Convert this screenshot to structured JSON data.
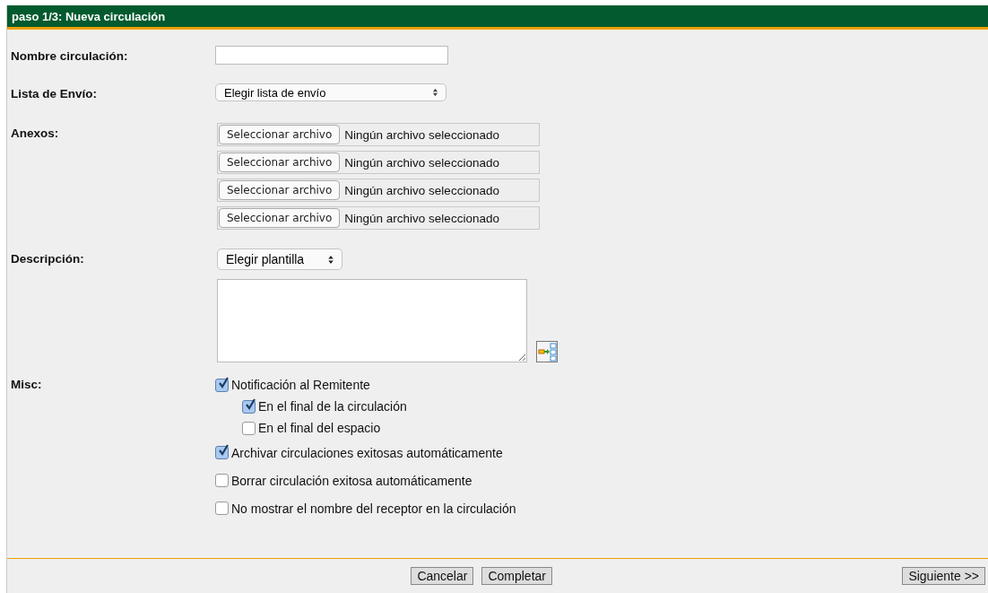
{
  "header": {
    "title": "paso 1/3: Nueva circulación"
  },
  "fields": [
    {
      "kind": "text",
      "label": "Nombre circulación:"
    },
    {
      "kind": "select",
      "label": "Lista de Envío:",
      "value": "Elegir lista de envío"
    },
    {
      "kind": "files",
      "label": "Anexos:",
      "files": [
        {
          "button": "Seleccionar archivo",
          "status": "Ningún archivo seleccionado"
        },
        {
          "button": "Seleccionar archivo",
          "status": "Ningún archivo seleccionado"
        },
        {
          "button": "Seleccionar archivo",
          "status": "Ningún archivo seleccionado"
        },
        {
          "button": "Seleccionar archivo",
          "status": "Ningún archivo seleccionado"
        }
      ]
    },
    {
      "kind": "description",
      "label": "Descripción:",
      "template": "Elegir plantilla"
    },
    {
      "kind": "checks",
      "label": "Misc:",
      "options": [
        {
          "label": "Notificación al Remitente",
          "checked": true,
          "children": [
            {
              "label": "En el final de la circulación",
              "checked": true
            },
            {
              "label": "En el final del espacio",
              "checked": false
            }
          ]
        },
        {
          "label": "Archivar circulaciones exitosas automáticamente",
          "checked": true
        },
        {
          "label": "Borrar circulación exitosa automáticamente",
          "checked": false
        },
        {
          "label": "No mostrar el nombre del receptor en la circulación",
          "checked": false
        }
      ]
    }
  ],
  "footer": {
    "buttons": [
      "Cancelar",
      "Completar"
    ],
    "next": "Siguiente >>"
  }
}
